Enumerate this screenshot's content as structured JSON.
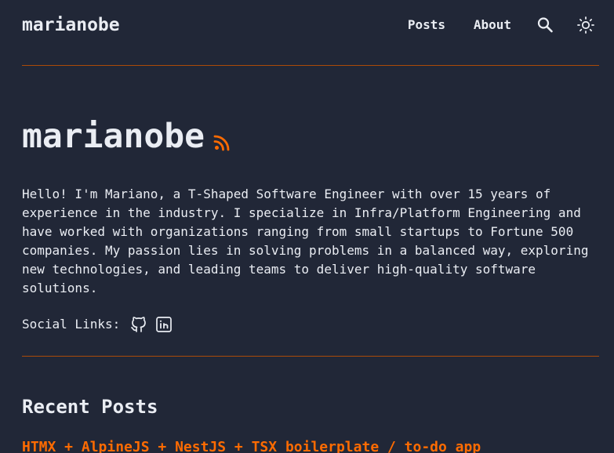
{
  "colors": {
    "background": "#212737",
    "text": "#eaedf3",
    "accent": "#ff6b01",
    "border": "#ab4b08"
  },
  "header": {
    "site_title": "marianobe",
    "nav": {
      "posts_label": "Posts",
      "about_label": "About"
    },
    "icons": {
      "search": "search-icon",
      "theme": "sun-icon"
    }
  },
  "hero": {
    "title": "marianobe",
    "rss_icon": "rss-icon",
    "bio": "Hello! I'm Mariano, a T-Shaped Software Engineer with over 15 years of\nexperience in the industry. I specialize in Infra/Platform Engineering and\nhave worked with organizations ranging from small startups to Fortune 500\ncompanies. My passion lies in solving problems in a balanced way, exploring\nnew technologies, and leading teams to deliver high-quality software\nsolutions."
  },
  "social": {
    "label": "Social Links:",
    "links": [
      "github-icon",
      "linkedin-icon"
    ]
  },
  "recent_posts": {
    "title": "Recent Posts",
    "items": [
      {
        "title": "HTMX + AlpineJS + NestJS + TSX boilerplate / to-do app"
      }
    ]
  }
}
